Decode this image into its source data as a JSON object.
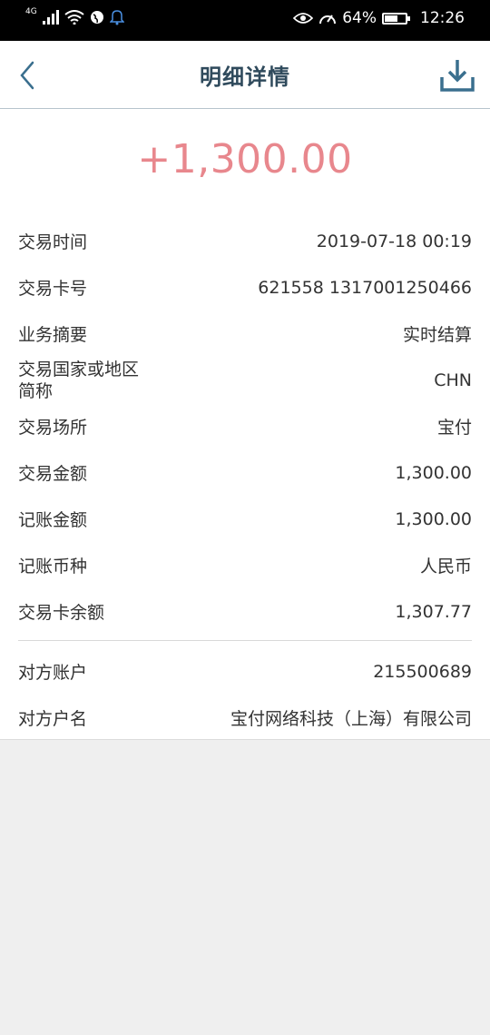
{
  "status_bar": {
    "network": "4G",
    "battery": "64%",
    "battery_level": 0.64,
    "time": "12:26"
  },
  "header": {
    "title": "明细详情"
  },
  "amount": "+1,300.00",
  "colors": {
    "amount": "#e8878d",
    "title": "#2f4a5c",
    "icon": "#3a6f8e"
  },
  "details": [
    {
      "label": "交易时间",
      "value": "2019-07-18 00:19"
    },
    {
      "label": "交易卡号",
      "value": "621558 1317001250466"
    },
    {
      "label": "业务摘要",
      "value": "实时结算"
    },
    {
      "label_line1": "交易国家或地区",
      "label_line2": "简称",
      "value": "CHN"
    },
    {
      "label": "交易场所",
      "value": "宝付"
    },
    {
      "label": "交易金额",
      "value": "1,300.00"
    },
    {
      "label": "记账金额",
      "value": "1,300.00"
    },
    {
      "label": "记账币种",
      "value": "人民币"
    },
    {
      "label": "交易卡余额",
      "value": "1,307.77"
    }
  ],
  "counterparty": [
    {
      "label": "对方账户",
      "value": "215500689"
    },
    {
      "label": "对方户名",
      "value": "宝付网络科技（上海）有限公司"
    }
  ]
}
